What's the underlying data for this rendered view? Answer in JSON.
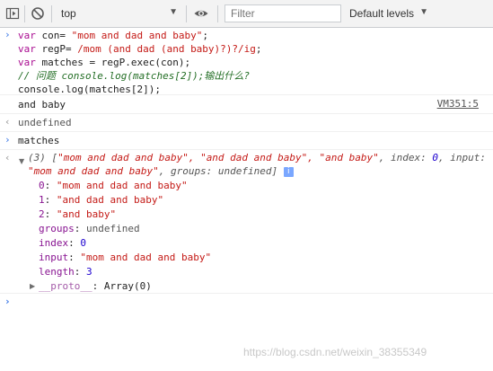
{
  "toolbar": {
    "context": "top",
    "filter_placeholder": "Filter",
    "levels": "Default levels",
    "sidebar_icon": "sidebar-toggle-icon",
    "clear_icon": "clear-console-icon",
    "eye_icon": "eye-icon",
    "caret": "▼"
  },
  "input_code": {
    "line1": {
      "kw": "var",
      "rest": " con= ",
      "str": "\"mom and dad and baby\"",
      "end": ";"
    },
    "line2": {
      "kw": "var",
      "rest": " regP= ",
      "regex": "/mom (and dad (and baby)?)?/ig",
      "end": ";"
    },
    "line3": {
      "kw": "var",
      "rest": " matches = regP.exec(con);"
    },
    "line4": "// 问题 console.log(matches[2]);输出什么?",
    "line5": "console.log(matches[2]);"
  },
  "log_output": {
    "text": "and baby",
    "source": "VM351:5"
  },
  "return_value": "undefined",
  "input2": "matches",
  "array_summary": {
    "line1_a": "(3) [",
    "line1_items": "\"mom and dad and baby\", \"and dad and baby\", \"and baby\"",
    "line1_b": ", index: ",
    "line1_index": "0",
    "line1_c": ", input:",
    "line2_input": "\"mom and dad and baby\"",
    "line2_b": ", groups: undefined]",
    "badge": "i"
  },
  "props": [
    {
      "key": "0",
      "val": "\"mom and dad and baby\""
    },
    {
      "key": "1",
      "val": "\"and dad and baby\""
    },
    {
      "key": "2",
      "val": "\"and baby\""
    },
    {
      "key": "groups",
      "val": "undefined"
    },
    {
      "key": "index",
      "val": "0"
    },
    {
      "key": "input",
      "val": "\"mom and dad and baby\""
    },
    {
      "key": "length",
      "val": "3"
    },
    {
      "key": "__proto__",
      "val": "Array(0)"
    }
  ],
  "prompt_icon": "›",
  "return_icon": "‹",
  "expand_icon": "▼",
  "collapse_icon": "▶",
  "watermark": "https://blog.csdn.net/weixin_38355349"
}
